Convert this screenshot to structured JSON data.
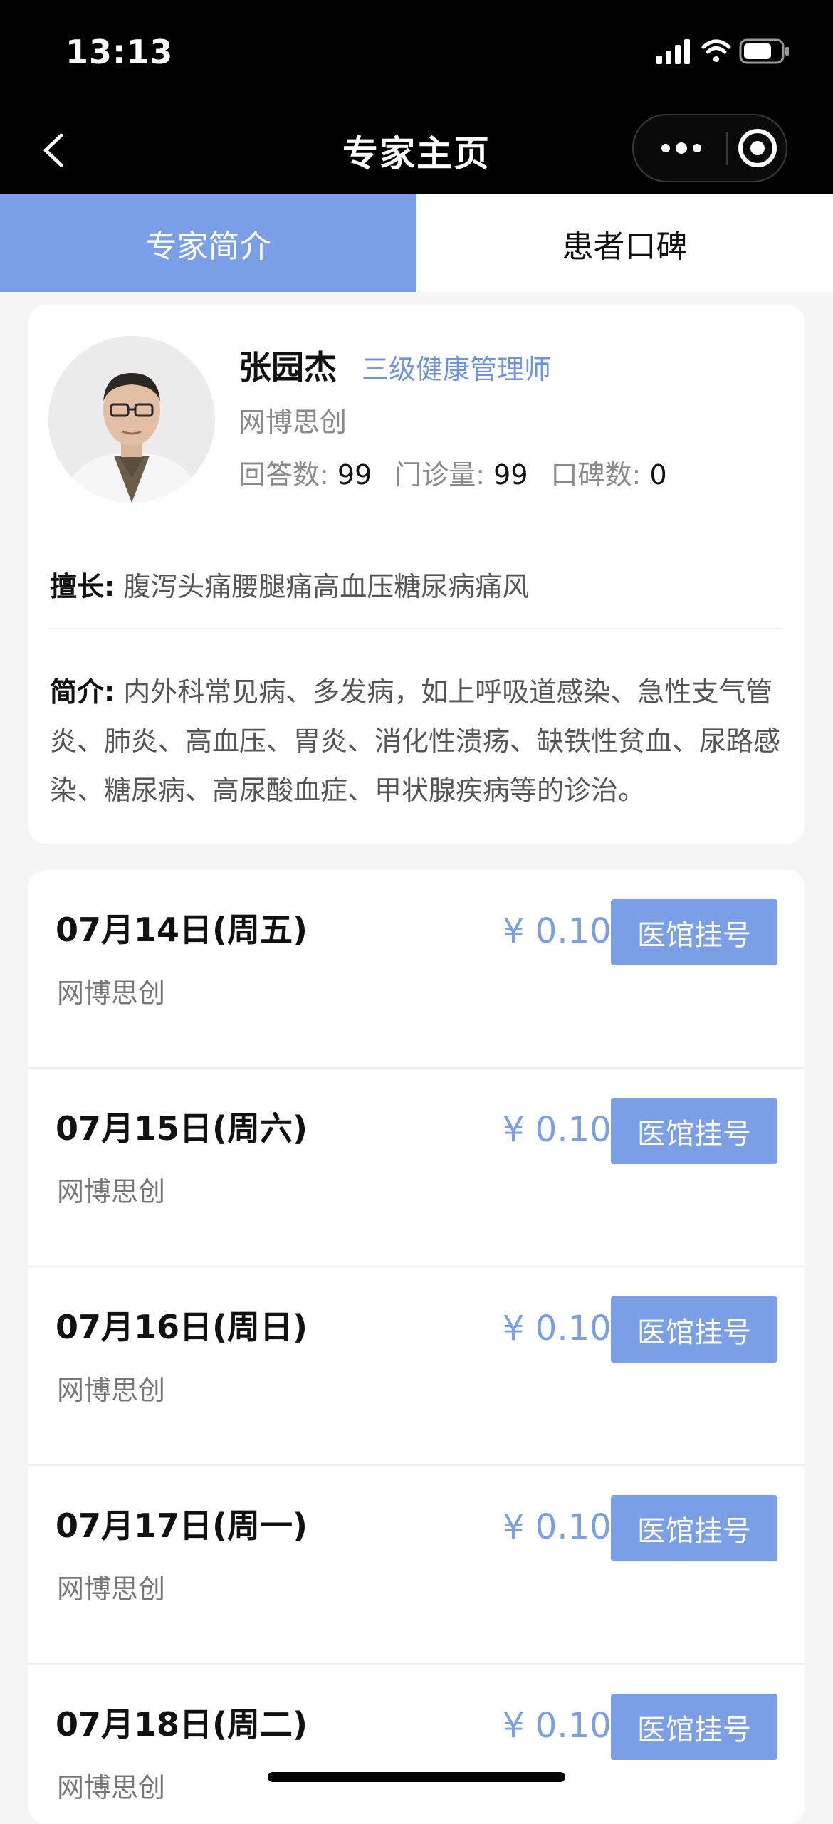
{
  "status_bar": {
    "time": "13:13"
  },
  "navbar": {
    "title": "专家主页"
  },
  "tabs": [
    {
      "label": "专家简介",
      "active": true
    },
    {
      "label": "患者口碑",
      "active": false
    }
  ],
  "profile": {
    "name": "张园杰",
    "title": "三级健康管理师",
    "organization": "网博思创",
    "stats": [
      {
        "label": "回答数:",
        "value": "99"
      },
      {
        "label": "门诊量:",
        "value": "99"
      },
      {
        "label": "口碑数:",
        "value": "0"
      }
    ],
    "specialty_label": "擅长:",
    "specialty": "腹泻头痛腰腿痛高血压糖尿病痛风",
    "intro_label": "简介:",
    "intro": "内外科常见病、多发病，如上呼吸道感染、急性支气管炎、肺炎、高血压、胃炎、消化性溃疡、缺铁性贫血、尿路感染、糖尿病、高尿酸血症、甲状腺疾病等的诊治。"
  },
  "schedule": [
    {
      "date": "07月14日(周五)",
      "org": "网博思创",
      "price": "¥ 0.10",
      "button": "医馆挂号"
    },
    {
      "date": "07月15日(周六)",
      "org": "网博思创",
      "price": "¥ 0.10",
      "button": "医馆挂号"
    },
    {
      "date": "07月16日(周日)",
      "org": "网博思创",
      "price": "¥ 0.10",
      "button": "医馆挂号"
    },
    {
      "date": "07月17日(周一)",
      "org": "网博思创",
      "price": "¥ 0.10",
      "button": "医馆挂号"
    },
    {
      "date": "07月18日(周二)",
      "org": "网博思创",
      "price": "¥ 0.10",
      "button": "医馆挂号"
    }
  ],
  "colors": {
    "accent": "#7b9fe6",
    "title_accent": "#6f93df",
    "background": "#f5f5f5"
  }
}
